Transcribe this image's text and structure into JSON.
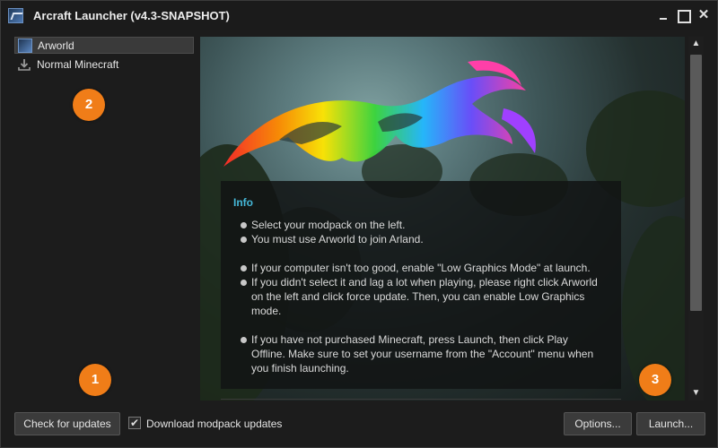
{
  "window": {
    "title": "Arcraft Launcher (v4.3-SNAPSHOT)",
    "icons": [
      "app-icon",
      "minimize-icon",
      "maximize-icon",
      "close-icon"
    ],
    "close_glyph": "✕"
  },
  "sidebar": {
    "items": [
      {
        "label": "Arworld",
        "icon": "arworld-icon",
        "selected": true
      },
      {
        "label": "Normal Minecraft",
        "icon": "download-icon",
        "selected": false
      }
    ]
  },
  "markers": {
    "one": "1",
    "two": "2",
    "three": "3"
  },
  "info": {
    "title": "Info",
    "lines": [
      "Select your modpack on the left.",
      "You must use Arworld to join Arland.",
      "If your computer isn't too good, enable \"Low Graphics Mode\" at launch.",
      "If you didn't select it and lag a lot when playing, please right click Arworld",
      "on the left and click force update. Then, you can enable Low Graphics",
      "mode.",
      "If you have not purchased Minecraft, press Launch, then click Play",
      "Offline. Make sure to set your username from the \"Account\" menu when",
      "you finish launching."
    ],
    "title_color": "#45b8d8"
  },
  "scrollbar": {
    "up_glyph": "▲",
    "down_glyph": "▼"
  },
  "bottom": {
    "check_updates_label": "Check for updates",
    "download_updates_label": "Download modpack updates",
    "download_updates_checked": true,
    "check_glyph": "✔",
    "options_label": "Options...",
    "launch_label": "Launch..."
  },
  "colors": {
    "marker": "#f07d18",
    "accent": "#45b8d8"
  }
}
